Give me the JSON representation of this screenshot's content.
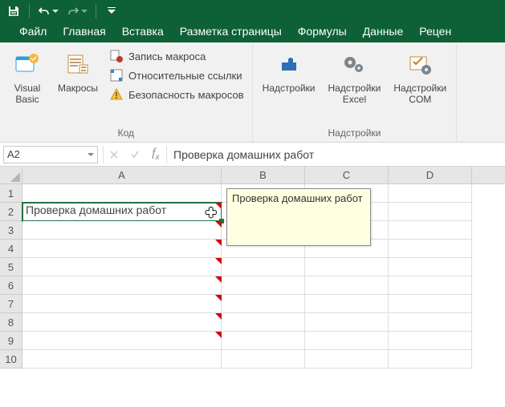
{
  "tabs": {
    "file": "Файл",
    "home": "Главная",
    "insert": "Вставка",
    "layout": "Разметка страницы",
    "formulas": "Формулы",
    "data": "Данные",
    "review": "Рецен"
  },
  "ribbon": {
    "visual_basic": "Visual\nBasic",
    "macros": "Макросы",
    "record_macro": "Запись макроса",
    "relative_refs": "Относительные ссылки",
    "macro_security": "Безопасность макросов",
    "group_code": "Код",
    "addins": "Надстройки",
    "excel_addins": "Надстройки\nExcel",
    "com_addins": "Надстройки\nCOM",
    "group_addins": "Надстройки"
  },
  "fx": {
    "namebox": "A2",
    "value": "Проверка домашних работ"
  },
  "columns": [
    "A",
    "B",
    "C",
    "D"
  ],
  "rows": [
    "1",
    "2",
    "3",
    "4",
    "5",
    "6",
    "7",
    "8",
    "9",
    "10"
  ],
  "cellA2": "Проверка домашних работ",
  "tooltip": "Проверка домашних работ"
}
